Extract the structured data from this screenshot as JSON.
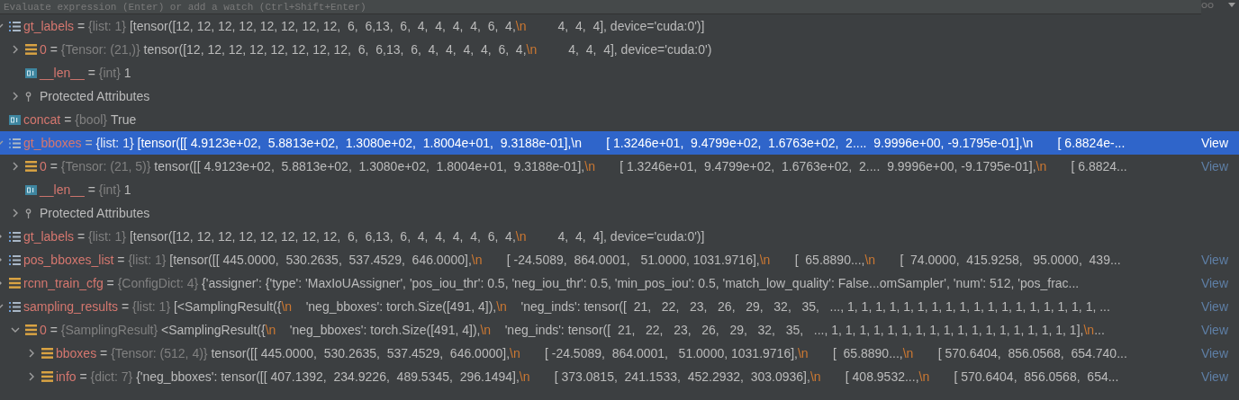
{
  "watch_field": {
    "placeholder": "Evaluate expression (Enter) or add a watch (Ctrl+Shift+Enter)"
  },
  "variables": [
    {
      "kind": "list",
      "name": "gt_labels",
      "sign": "=",
      "type": "{list: 1}",
      "expanded": true,
      "selected": false,
      "value": [
        {
          "kind": "code",
          "text": "[tensor([12, 12, 12, 12, 12, 12, 12, 12,  6,  6,13,  6,  4,  4,  4,  4,  6,  4,"
        },
        {
          "kind": "escape",
          "text": "\\n"
        },
        {
          "kind": "code",
          "text": "         4,  4,  4], device='cuda:0')]"
        }
      ],
      "children": [
        {
          "kind": "array",
          "name": "0",
          "sign": "=",
          "type": "{Tensor: (21,)}",
          "expanded": false,
          "selected": false,
          "value": [
            {
              "kind": "code",
              "text": "tensor([12, 12, 12, 12, 12, 12, 12, 12,  6,  6,13,  6,  4,  4,  4,  4,  6,  4,"
            },
            {
              "kind": "escape",
              "text": "\\n"
            },
            {
              "kind": "code",
              "text": "         4,  4,  4], device='cuda:0')"
            }
          ]
        },
        {
          "kind": "scalar",
          "name": "__len__",
          "sign": "=",
          "type": "{int}",
          "selected": false,
          "value": [
            {
              "kind": "code",
              "text": "1"
            }
          ]
        },
        {
          "kind": "group",
          "name": "Protected Attributes",
          "expanded": false,
          "selected": false
        }
      ]
    },
    {
      "kind": "scalar",
      "name": "concat",
      "sign": "=",
      "type": "{bool}",
      "selected": false,
      "value": [
        {
          "kind": "code",
          "text": "True"
        }
      ]
    },
    {
      "kind": "list",
      "name": "gt_bboxes",
      "sign": "=",
      "type": "{list: 1}",
      "expanded": true,
      "selected": true,
      "view": "View",
      "value": [
        {
          "kind": "code",
          "text": "[tensor([[ 4.9123e+02,  5.8813e+02,  1.3080e+02,  1.8004e+01,  9.3188e-01],"
        },
        {
          "kind": "escape",
          "text": "\\n"
        },
        {
          "kind": "code",
          "text": "       [ 1.3246e+01,  9.4799e+02,  1.6763e+02,  2....  9.9996e+00, -9.1795e-01],"
        },
        {
          "kind": "escape",
          "text": "\\n"
        },
        {
          "kind": "code",
          "text": "       [ 6.8824e-..."
        }
      ],
      "children": [
        {
          "kind": "array",
          "name": "0",
          "sign": "=",
          "type": "{Tensor: (21, 5)}",
          "expanded": false,
          "selected": false,
          "view": "View",
          "value": [
            {
              "kind": "code",
              "text": "tensor([[ 4.9123e+02,  5.8813e+02,  1.3080e+02,  1.8004e+01,  9.3188e-01],"
            },
            {
              "kind": "escape",
              "text": "\\n"
            },
            {
              "kind": "code",
              "text": "       [ 1.3246e+01,  9.4799e+02,  1.6763e+02,  2....  9.9996e+00, -9.1795e-01],"
            },
            {
              "kind": "escape",
              "text": "\\n"
            },
            {
              "kind": "code",
              "text": "       [ 6.8824..."
            }
          ]
        },
        {
          "kind": "scalar",
          "name": "__len__",
          "sign": "=",
          "type": "{int}",
          "selected": false,
          "value": [
            {
              "kind": "code",
              "text": "1"
            }
          ]
        },
        {
          "kind": "group",
          "name": "Protected Attributes",
          "expanded": false,
          "selected": false
        }
      ]
    },
    {
      "kind": "list",
      "name": "gt_labels",
      "sign": "=",
      "type": "{list: 1}",
      "expanded": false,
      "selected": false,
      "value": [
        {
          "kind": "code",
          "text": "[tensor([12, 12, 12, 12, 12, 12, 12, 12,  6,  6,13,  6,  4,  4,  4,  4,  6,  4,"
        },
        {
          "kind": "escape",
          "text": "\\n"
        },
        {
          "kind": "code",
          "text": "         4,  4,  4], device='cuda:0')]"
        }
      ]
    },
    {
      "kind": "list",
      "name": "pos_bboxes_list",
      "sign": "=",
      "type": "{list: 1}",
      "expanded": false,
      "selected": false,
      "view": "View",
      "value": [
        {
          "kind": "code",
          "text": "[tensor([[ 445.0000,  530.2635,  537.4529,  646.0000],"
        },
        {
          "kind": "escape",
          "text": "\\n"
        },
        {
          "kind": "code",
          "text": "       [ -24.5089,  864.0001,   51.0000, 1031.9716],"
        },
        {
          "kind": "escape",
          "text": "\\n"
        },
        {
          "kind": "code",
          "text": "       [  65.8890...,"
        },
        {
          "kind": "escape",
          "text": "\\n"
        },
        {
          "kind": "code",
          "text": "       [  74.0000,  415.9258,   95.0000,  439..."
        }
      ]
    },
    {
      "kind": "array",
      "name": "rcnn_train_cfg",
      "sign": "=",
      "type": "{ConfigDict: 4}",
      "expanded": false,
      "selected": false,
      "view": "View",
      "value": [
        {
          "kind": "code",
          "text": "{'assigner': {'type': 'MaxIoUAssigner', 'pos_iou_thr': 0.5, 'neg_iou_thr': 0.5, 'min_pos_iou': 0.5, 'match_low_quality': False...omSampler', 'num': 512, 'pos_frac..."
        }
      ]
    },
    {
      "kind": "list",
      "name": "sampling_results",
      "sign": "=",
      "type": "{list: 1}",
      "expanded": true,
      "selected": false,
      "view": "View",
      "value": [
        {
          "kind": "code",
          "text": "[<SamplingResult({"
        },
        {
          "kind": "escape",
          "text": "\\n"
        },
        {
          "kind": "code",
          "text": "    'neg_bboxes': torch.Size([491, 4]),"
        },
        {
          "kind": "escape",
          "text": "\\n"
        },
        {
          "kind": "code",
          "text": "    'neg_inds': tensor([  21,   22,   23,   26,   29,   32,   35,   ..., 1, 1, 1, 1, 1, 1, 1, 1, 1, 1, 1, 1, 1, 1, 1, 1, 1, 1, ..."
        }
      ],
      "children": [
        {
          "kind": "array",
          "name": "0",
          "sign": "=",
          "type": "{SamplingResult}",
          "expanded": true,
          "selected": false,
          "view": "View",
          "value": [
            {
              "kind": "code",
              "text": "<SamplingResult({"
            },
            {
              "kind": "escape",
              "text": "\\n"
            },
            {
              "kind": "code",
              "text": "    'neg_bboxes': torch.Size([491, 4]),"
            },
            {
              "kind": "escape",
              "text": "\\n"
            },
            {
              "kind": "code",
              "text": "    'neg_inds': tensor([  21,   22,   23,   26,   29,   32,   35,   ..., 1, 1, 1, 1, 1, 1, 1, 1, 1, 1, 1, 1, 1, 1, 1, 1, 1, 1],"
            },
            {
              "kind": "escape",
              "text": "\\n"
            },
            {
              "kind": "code",
              "text": "..."
            }
          ],
          "children": [
            {
              "kind": "array",
              "name": "bboxes",
              "sign": "=",
              "type": "{Tensor: (512, 4)}",
              "expanded": false,
              "selected": false,
              "view": "View",
              "value": [
                {
                  "kind": "code",
                  "text": "tensor([[ 445.0000,  530.2635,  537.4529,  646.0000],"
                },
                {
                  "kind": "escape",
                  "text": "\\n"
                },
                {
                  "kind": "code",
                  "text": "       [ -24.5089,  864.0001,   51.0000, 1031.9716],"
                },
                {
                  "kind": "escape",
                  "text": "\\n"
                },
                {
                  "kind": "code",
                  "text": "       [  65.8890...,"
                },
                {
                  "kind": "escape",
                  "text": "\\n"
                },
                {
                  "kind": "code",
                  "text": "       [ 570.6404,  856.0568,  654.740..."
                }
              ]
            },
            {
              "kind": "array",
              "name": "info",
              "sign": "=",
              "type": "{dict: 7}",
              "expanded": false,
              "selected": false,
              "view": "View",
              "value": [
                {
                  "kind": "code",
                  "text": "{'neg_bboxes': tensor([[ 407.1392,  234.9226,  489.5345,  296.1494],"
                },
                {
                  "kind": "escape",
                  "text": "\\n"
                },
                {
                  "kind": "code",
                  "text": "       [ 373.0815,  241.1533,  452.2932,  303.0936],"
                },
                {
                  "kind": "escape",
                  "text": "\\n"
                },
                {
                  "kind": "code",
                  "text": "       [ 408.9532...,"
                },
                {
                  "kind": "escape",
                  "text": "\\n"
                },
                {
                  "kind": "code",
                  "text": "       [ 570.6404,  856.0568,  654..."
                }
              ]
            }
          ]
        }
      ]
    }
  ]
}
